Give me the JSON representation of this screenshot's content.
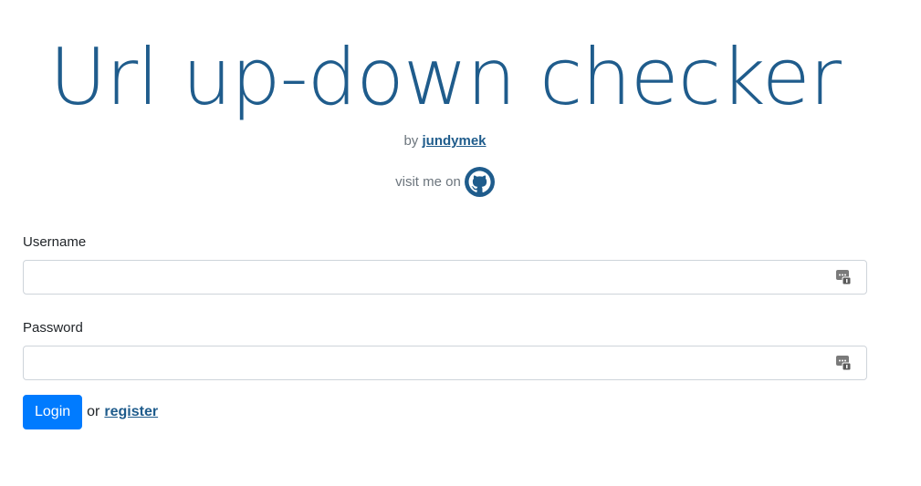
{
  "header": {
    "title": "Url up-down checker",
    "by_prefix": "by",
    "author": "jundymek",
    "visit_text": "visit me on",
    "github_icon": "github-icon"
  },
  "form": {
    "username_label": "Username",
    "username_value": "",
    "password_label": "Password",
    "password_value": "",
    "field_icon": "password-manager-icon"
  },
  "actions": {
    "login_label": "Login",
    "or_text": "or",
    "register_label": "register"
  },
  "colors": {
    "title": "#1f5c8c",
    "primary": "#007bff",
    "muted": "#6c757d",
    "link": "#1f5c8c"
  }
}
